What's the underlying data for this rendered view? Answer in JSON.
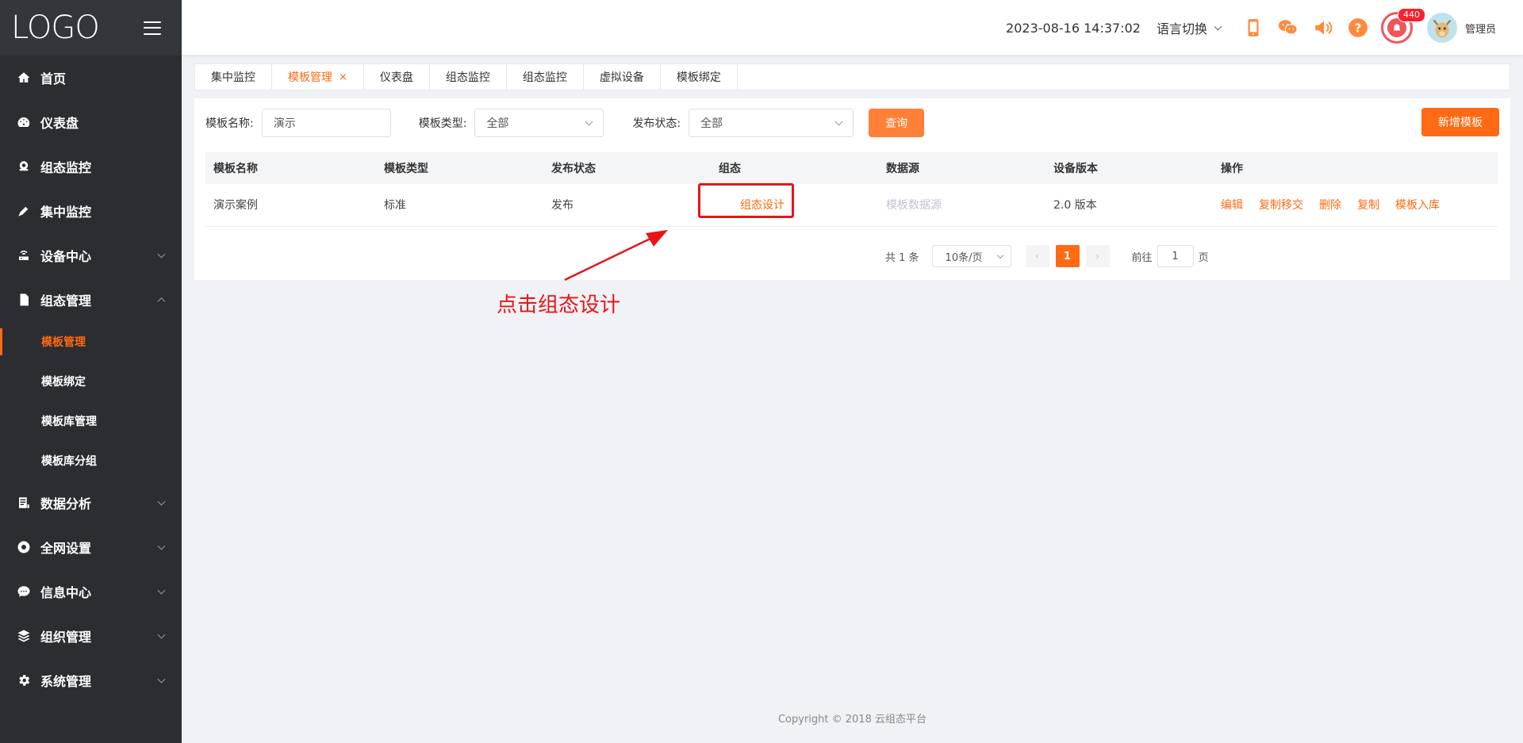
{
  "sidebar": {
    "logo": "LOGO",
    "items": [
      {
        "label": "首页",
        "icon": "home-icon"
      },
      {
        "label": "仪表盘",
        "icon": "dashboard-icon"
      },
      {
        "label": "组态监控",
        "icon": "monitor-icon"
      },
      {
        "label": "集中监控",
        "icon": "pen-icon"
      },
      {
        "label": "设备中心",
        "icon": "router-icon"
      },
      {
        "label": "组态管理",
        "icon": "document-icon"
      },
      {
        "label": "数据分析",
        "icon": "report-icon"
      },
      {
        "label": "全网设置",
        "icon": "settings-ring-icon"
      },
      {
        "label": "信息中心",
        "icon": "chat-icon"
      },
      {
        "label": "组织管理",
        "icon": "layers-icon"
      },
      {
        "label": "系统管理",
        "icon": "gear-icon"
      }
    ],
    "submenu": [
      "模板管理",
      "模板绑定",
      "模板库管理",
      "模板库分组"
    ]
  },
  "header": {
    "datetime": "2023-08-16 14:37:02",
    "language": "语言切换",
    "alarm_count": "440",
    "username": "管理员"
  },
  "tabs": [
    "集中监控",
    "模板管理",
    "仪表盘",
    "组态监控",
    "组态监控",
    "虚拟设备",
    "模板绑定"
  ],
  "tab_close": "×",
  "filters": {
    "name_label": "模板名称:",
    "name_value": "演示",
    "type_label": "模板类型:",
    "type_value": "全部",
    "status_label": "发布状态:",
    "status_value": "全部",
    "query_button": "查询",
    "add_button": "新增模板"
  },
  "table": {
    "headers": [
      "模板名称",
      "模板类型",
      "发布状态",
      "组态",
      "数据源",
      "设备版本",
      "操作"
    ],
    "rows": [
      {
        "name": "演示案例",
        "type": "标准",
        "status": "发布",
        "design": "组态设计",
        "datasource": "模板数据源",
        "version": "2.0 版本",
        "ops": [
          "编辑",
          "复制移交",
          "删除",
          "复制",
          "模板入库"
        ]
      }
    ]
  },
  "pager": {
    "total": "共 1 条",
    "page_size": "10条/页",
    "current": "1",
    "goto_label": "前往",
    "goto_value": "1",
    "page_unit": "页"
  },
  "annotation": "点击组态设计",
  "footer": "Copyright © 2018 云组态平台",
  "colors": {
    "accent": "#ff6a13",
    "sidebar": "#2b2d31",
    "annotation": "#e8141a"
  }
}
